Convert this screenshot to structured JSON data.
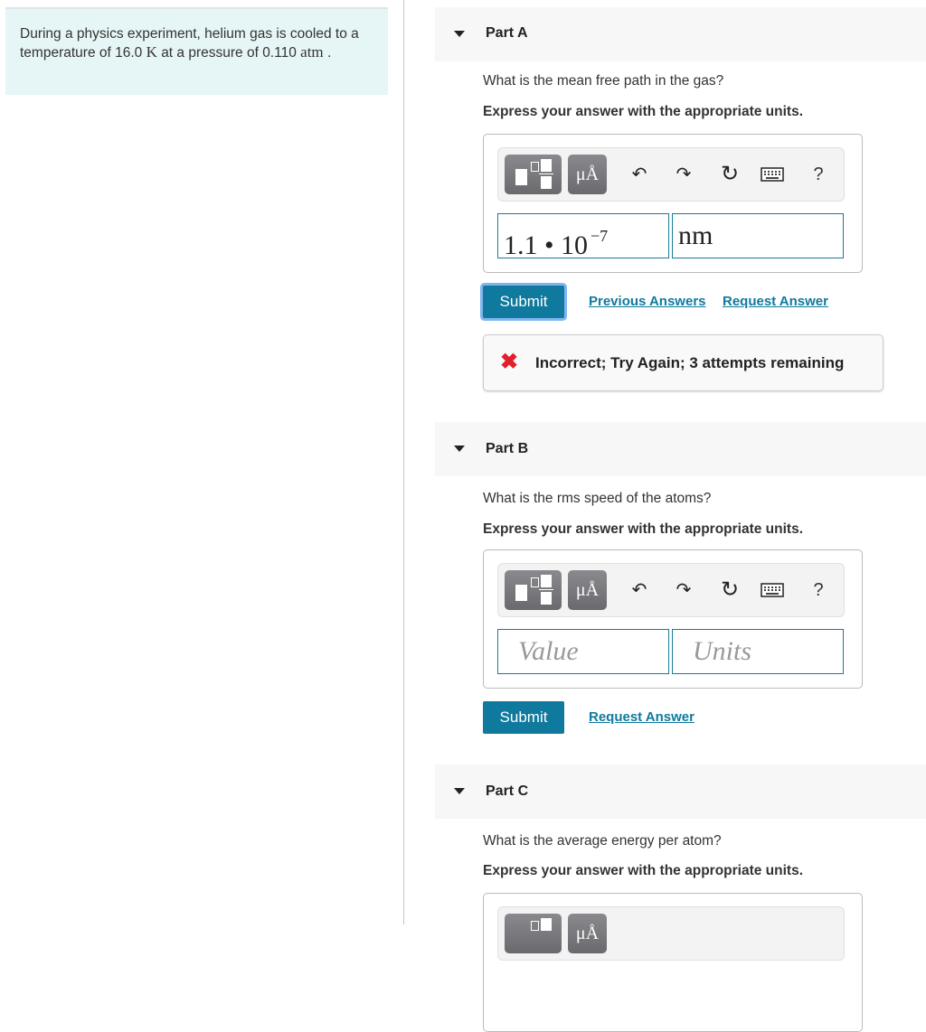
{
  "problem": {
    "text_before_temp": "During a physics experiment, helium gas is cooled to a temperature of 16.0",
    "temp_unit": "K",
    "text_mid": "at a pressure of 0.110",
    "pressure_unit": "atm",
    "text_end": "."
  },
  "toolbar": {
    "templates_icon": "templates-icon",
    "units_label": "μÅ",
    "undo_icon": "↶",
    "redo_icon": "↷",
    "reset_icon": "↻",
    "keyboard_icon": "keyboard-icon",
    "help_label": "?"
  },
  "parts": [
    {
      "title": "Part A",
      "question": "What is the mean free path in the gas?",
      "instruction": "Express your answer with the appropriate units.",
      "value_mantissa": "1.1 • 10",
      "value_exponent": "−7",
      "units_value": "nm",
      "submit_label": "Submit",
      "previous_answers_label": "Previous Answers",
      "request_answer_label": "Request Answer",
      "feedback": "Incorrect; Try Again; 3 attempts remaining"
    },
    {
      "title": "Part B",
      "question": "What is the rms speed of the atoms?",
      "instruction": "Express your answer with the appropriate units.",
      "value_placeholder": "Value",
      "units_placeholder": "Units",
      "submit_label": "Submit",
      "request_answer_label": "Request Answer"
    },
    {
      "title": "Part C",
      "question": "What is the average energy per atom?",
      "instruction": "Express your answer with the appropriate units."
    }
  ],
  "colors": {
    "accent": "#0f7a9d",
    "error": "#e0202a",
    "problem_bg": "#e6f5f5"
  }
}
